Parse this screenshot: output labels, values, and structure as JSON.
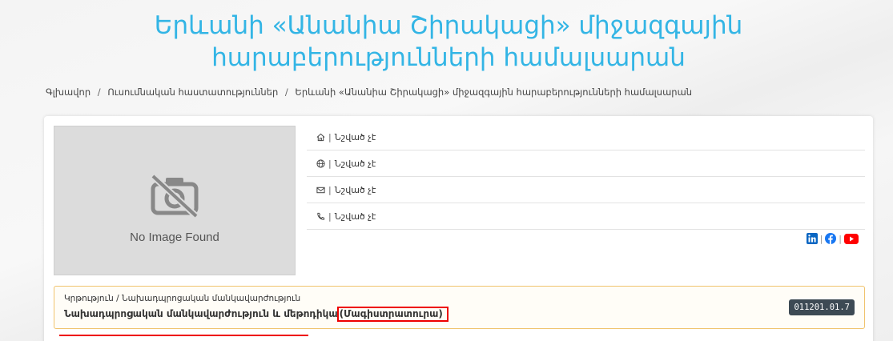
{
  "page_title": "Երևանի «Անանիա Շիրակացի» միջազգային հարաբերությունների համալսարան",
  "breadcrumb": {
    "home": "Գլխավոր",
    "institutions": "Ուսումնական հաստատություններ",
    "current": "Երևանի «Անանիա Շիրակացի» միջազգային հարաբերությունների համալսարան",
    "separator": "/"
  },
  "image_placeholder": {
    "label": "No Image Found",
    "icon": "no-camera-icon"
  },
  "contacts": [
    {
      "icon": "home-icon",
      "value": "Նշված չէ"
    },
    {
      "icon": "globe-icon",
      "value": "Նշված չէ"
    },
    {
      "icon": "envelope-icon",
      "value": "Նշված չէ"
    },
    {
      "icon": "phone-icon",
      "value": "Նշված չէ"
    }
  ],
  "social": {
    "linkedin_color": "#0a66c2",
    "facebook_color": "#1877f2",
    "youtube_color": "#ff0000"
  },
  "education": {
    "path": "Կրթություն / Նախադպրոցական մանկավարժություն",
    "program_name": "Նախադպրոցական մանկավարժություն և մեթոդիկա",
    "program_type": "(Մագիստրատուրա)",
    "code": "011201.01.7"
  },
  "colors": {
    "accent": "#33b5e5",
    "highlight_border": "#f0c36d",
    "annotation_red": "#ee0000",
    "badge_bg": "#3d4a54"
  }
}
